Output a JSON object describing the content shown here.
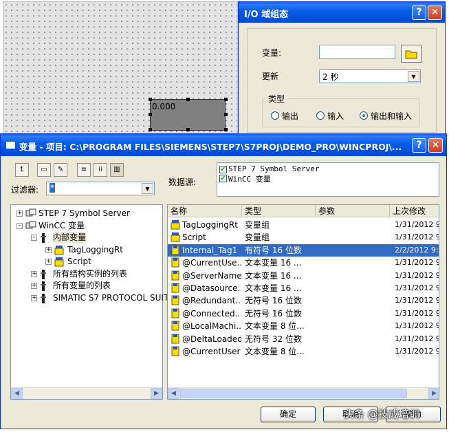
{
  "canvas": {
    "io_field_value": "0.000"
  },
  "io_dialog": {
    "title": "I/O 域组态",
    "help_label": "?",
    "close_label": "✕",
    "variable_label": "变量:",
    "variable_value": "",
    "update_label": "更新",
    "update_value": "2 秒",
    "type_group_label": "类型",
    "radios": [
      {
        "label": "输出",
        "checked": false
      },
      {
        "label": "输入",
        "checked": false
      },
      {
        "label": "输出和输入",
        "checked": true
      }
    ]
  },
  "main_dialog": {
    "title": "变量 - 项目: C:\\PROGRAM FILES\\SIEMENS\\STEP7\\S7PROJ\\DEMO_PRO\\WINCPROJ\\...",
    "help_label": "?",
    "close_label": "✕",
    "filter_label": "过滤器:",
    "filter_value": "*",
    "datasource_label": "数据源:",
    "datasources": [
      {
        "label": "STEP 7 Symbol Server",
        "checked": true
      },
      {
        "label": "WinCC 变量",
        "checked": true
      }
    ],
    "tree": [
      {
        "label": "STEP 7 Symbol Server",
        "expander": "+",
        "level": 0,
        "icon": "server-icon"
      },
      {
        "label": "WinCC 变量",
        "expander": "−",
        "level": 0,
        "icon": "server-icon"
      },
      {
        "label": "内部变量",
        "expander": "−",
        "level": 1,
        "icon": "connector-icon"
      },
      {
        "label": "TagLoggingRt",
        "expander": "+",
        "level": 2,
        "icon": "tag-group-icon"
      },
      {
        "label": "Script",
        "expander": "+",
        "level": 2,
        "icon": "tag-group-icon"
      },
      {
        "label": "所有结构实例的列表",
        "expander": "+",
        "level": 1,
        "icon": "connector-icon"
      },
      {
        "label": "所有变量的列表",
        "expander": "+",
        "level": 1,
        "icon": "connector-icon"
      },
      {
        "label": "SIMATIC S7 PROTOCOL SUIT",
        "expander": "+",
        "level": 1,
        "icon": "connector-icon"
      }
    ],
    "columns": [
      "名称",
      "类型",
      "参数",
      "上次修改"
    ],
    "rows": [
      {
        "name": "TagLoggingRt",
        "type": "变量组",
        "param": "",
        "modified": "1/31/2012 9",
        "icon": "tag-group-icon",
        "selected": false
      },
      {
        "name": "Script",
        "type": "变量组",
        "param": "",
        "modified": "1/31/2012 9",
        "icon": "tag-group-icon",
        "selected": false
      },
      {
        "name": "Internal_Tag1",
        "type": "有符号 16 位数",
        "param": "",
        "modified": "2/2/2012 9:",
        "icon": "tag-icon",
        "selected": true
      },
      {
        "name": "@CurrentUse...",
        "type": "文本变量 16 ...",
        "param": "",
        "modified": "1/31/2012 9",
        "icon": "tag-icon",
        "selected": false
      },
      {
        "name": "@ServerName",
        "type": "文本变量 16 ...",
        "param": "",
        "modified": "1/31/2012 9",
        "icon": "tag-icon",
        "selected": false
      },
      {
        "name": "@Datasource...",
        "type": "文本变量 16 ...",
        "param": "",
        "modified": "1/31/2012 9",
        "icon": "tag-icon",
        "selected": false
      },
      {
        "name": "@Redundant...",
        "type": "无符号 16 位数",
        "param": "",
        "modified": "1/31/2012 9",
        "icon": "tag-icon",
        "selected": false
      },
      {
        "name": "@Connected...",
        "type": "无符号 16 位数",
        "param": "",
        "modified": "1/31/2012 9",
        "icon": "tag-icon",
        "selected": false
      },
      {
        "name": "@LocalMachi...",
        "type": "文本变量 8 位...",
        "param": "",
        "modified": "1/31/2012 9",
        "icon": "tag-icon",
        "selected": false
      },
      {
        "name": "@DeltaLoaded",
        "type": "无符号 32 位数",
        "param": "",
        "modified": "1/31/2012 9",
        "icon": "tag-icon",
        "selected": false
      },
      {
        "name": "@CurrentUser",
        "type": "文本变量 8 位...",
        "param": "",
        "modified": "1/31/2012 9",
        "icon": "tag-icon",
        "selected": false
      }
    ],
    "ok_label": "确定",
    "cancel_label": "取消",
    "help_button_label": "帮助"
  },
  "watermark": "头条 @技成培训",
  "colors": {
    "title_blue": "#0a5ee8",
    "selection": "#316ac5",
    "dialog_bg": "#ece9d8",
    "close_red": "#c7401f"
  }
}
